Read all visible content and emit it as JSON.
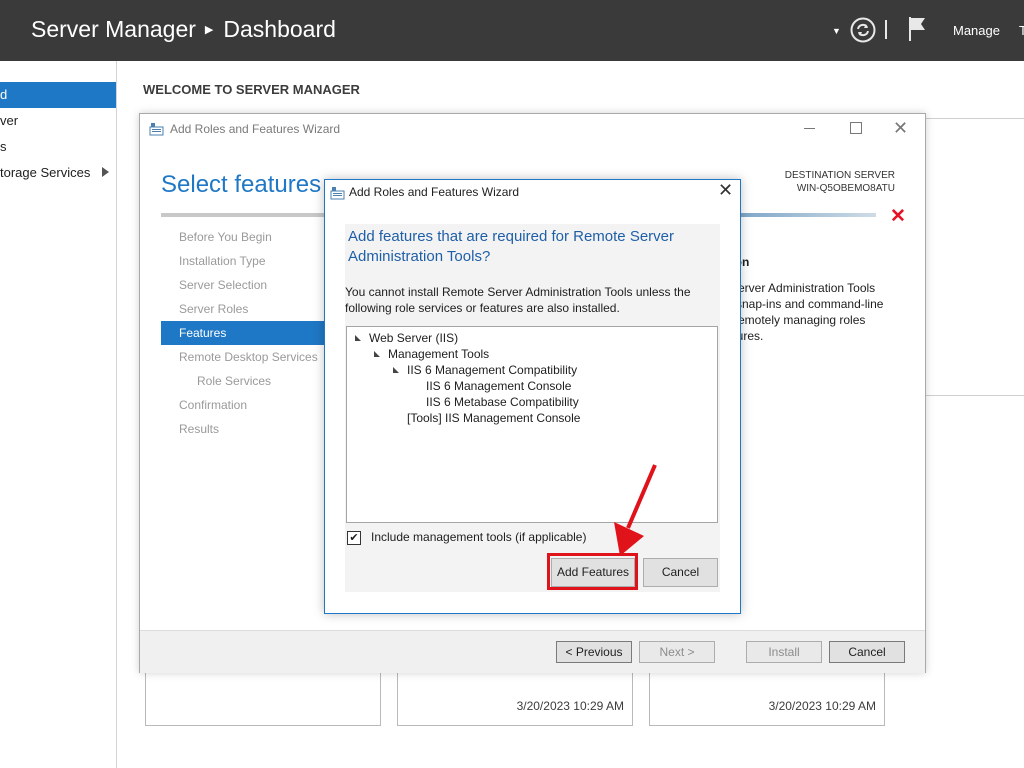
{
  "header": {
    "app_title": "Server Manager",
    "page_title": "Dashboard",
    "manage_label": "Manage",
    "tools_label": "Tools"
  },
  "nav": {
    "items": [
      "d",
      "ver",
      "s",
      "torage Services"
    ]
  },
  "welcome": "WELCOME TO SERVER MANAGER",
  "tiles": {
    "timestamps": [
      "3/20/2023 10:29 AM",
      "3/20/2023 10:29 AM"
    ]
  },
  "wizard": {
    "title": "Add Roles and Features Wizard",
    "page_heading": "Select features",
    "destination_label": "DESTINATION SERVER",
    "destination_server": "WIN-Q5OBEMO8ATU",
    "steps": [
      "Before You Begin",
      "Installation Type",
      "Server Selection",
      "Server Roles",
      "Features",
      "Remote Desktop Services",
      "Role Services",
      "Confirmation",
      "Results"
    ],
    "description_heading": "ption",
    "description_lines": [
      "e Server Administration Tools",
      "es snap-ins and command-line",
      "or remotely managing roles",
      "eatures."
    ],
    "buttons": {
      "previous": "< Previous",
      "next": "Next >",
      "install": "Install",
      "cancel": "Cancel"
    }
  },
  "dialog": {
    "title": "Add Roles and Features Wizard",
    "heading": "Add features that are required for Remote Server Administration Tools?",
    "message": "You cannot install Remote Server Administration Tools unless the following role services or features are also installed.",
    "tree": [
      {
        "label": "Web Server (IIS)",
        "expanded": true
      },
      {
        "label": "Management Tools",
        "expanded": true
      },
      {
        "label": "IIS 6 Management Compatibility",
        "expanded": true
      },
      {
        "label": "IIS 6 Management Console",
        "expanded": false
      },
      {
        "label": "IIS 6 Metabase Compatibility",
        "expanded": false
      },
      {
        "label": "[Tools] IIS Management Console",
        "expanded": false
      }
    ],
    "include_tools_label": "Include management tools (if applicable)",
    "include_tools_checked": true,
    "add_features_label": "Add Features",
    "cancel_label": "Cancel"
  },
  "colors": {
    "accent": "#1f78c5",
    "header_bg": "#3a3a3a",
    "annotation": "#e0121a"
  }
}
